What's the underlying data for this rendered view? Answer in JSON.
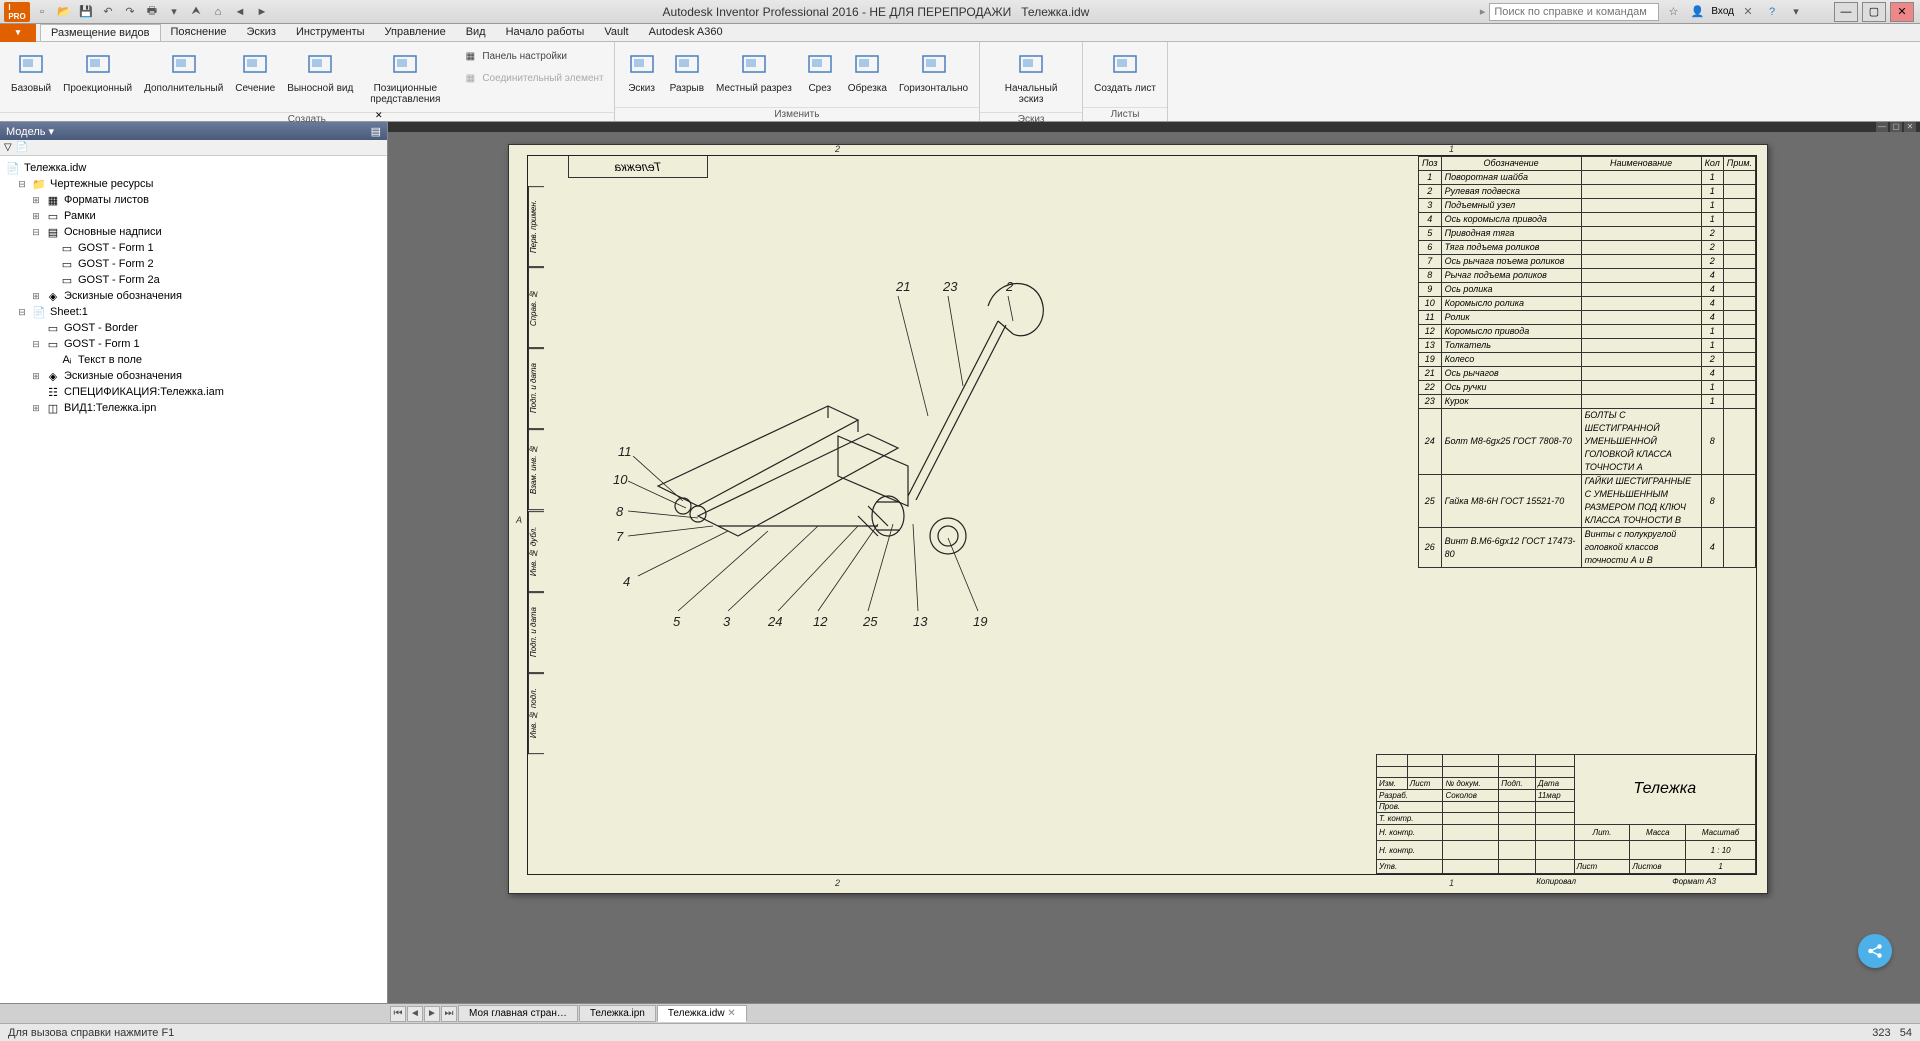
{
  "app": {
    "title_left": "Autodesk Inventor Professional 2016 - НЕ ДЛЯ ПЕРЕПРОДАЖИ",
    "title_doc": "Тележка.idw",
    "search_placeholder": "Поиск по справке и командам",
    "login": "Вход"
  },
  "qat": [
    "new",
    "open",
    "save",
    "undo",
    "redo",
    "print",
    "home",
    "back",
    "forward"
  ],
  "menus": [
    "Размещение видов",
    "Пояснение",
    "Эскиз",
    "Инструменты",
    "Управление",
    "Вид",
    "Начало работы",
    "Vault",
    "Autodesk A360"
  ],
  "ribbon": {
    "groups": [
      {
        "title": "Создать",
        "buttons": [
          {
            "label": "Базовый",
            "icon": "base-view"
          },
          {
            "label": "Проекционный",
            "icon": "projected-view"
          },
          {
            "label": "Дополнительный",
            "icon": "aux-view"
          },
          {
            "label": "Сечение",
            "icon": "section-view"
          },
          {
            "label": "Выносной вид",
            "icon": "detail-view"
          },
          {
            "label": "Позиционные представления",
            "icon": "overlay-view"
          }
        ],
        "side": [
          {
            "label": "Панель настройки",
            "icon": "nailboard",
            "disabled": false
          },
          {
            "label": "Соединительный элемент",
            "icon": "connector",
            "disabled": true
          }
        ]
      },
      {
        "title": "Изменить",
        "buttons": [
          {
            "label": "Эскиз",
            "icon": "sketch"
          },
          {
            "label": "Разрыв",
            "icon": "break"
          },
          {
            "label": "Местный разрез",
            "icon": "breakout"
          },
          {
            "label": "Срез",
            "icon": "slice"
          },
          {
            "label": "Обрезка",
            "icon": "crop"
          },
          {
            "label": "Горизонтально",
            "icon": "horizontal"
          }
        ]
      },
      {
        "title": "Эскиз",
        "buttons": [
          {
            "label": "Начальный эскиз",
            "icon": "start-sketch"
          }
        ]
      },
      {
        "title": "Листы",
        "buttons": [
          {
            "label": "Создать лист",
            "icon": "new-sheet"
          }
        ]
      }
    ]
  },
  "browser": {
    "title": "Модель",
    "root": "Тележка.idw",
    "nodes": [
      {
        "lvl": 1,
        "exp": "-",
        "icon": "folder",
        "label": "Чертежные ресурсы"
      },
      {
        "lvl": 2,
        "exp": "+",
        "icon": "sheets",
        "label": "Форматы листов"
      },
      {
        "lvl": 2,
        "exp": "+",
        "icon": "frame",
        "label": "Рамки"
      },
      {
        "lvl": 2,
        "exp": "-",
        "icon": "titleblk",
        "label": "Основные надписи"
      },
      {
        "lvl": 3,
        "exp": "",
        "icon": "form",
        "label": "GOST - Form 1"
      },
      {
        "lvl": 3,
        "exp": "",
        "icon": "form",
        "label": "GOST - Form 2"
      },
      {
        "lvl": 3,
        "exp": "",
        "icon": "form",
        "label": "GOST - Form 2a"
      },
      {
        "lvl": 2,
        "exp": "+",
        "icon": "symbols",
        "label": "Эскизные обозначения"
      },
      {
        "lvl": 1,
        "exp": "-",
        "icon": "sheet",
        "label": "Sheet:1"
      },
      {
        "lvl": 2,
        "exp": "",
        "icon": "border",
        "label": "GOST - Border"
      },
      {
        "lvl": 2,
        "exp": "-",
        "icon": "form",
        "label": "GOST - Form 1"
      },
      {
        "lvl": 3,
        "exp": "",
        "icon": "text",
        "label": "Текст в поле"
      },
      {
        "lvl": 2,
        "exp": "+",
        "icon": "symbols",
        "label": "Эскизные обозначения"
      },
      {
        "lvl": 2,
        "exp": "",
        "icon": "spec",
        "label": "СПЕЦИФИКАЦИЯ:Тележка.iam"
      },
      {
        "lvl": 2,
        "exp": "+",
        "icon": "view",
        "label": "ВИД1:Тележка.ipn"
      }
    ]
  },
  "sheet": {
    "title_rotated": "Тележка",
    "parts_header": {
      "poz": "Поз",
      "oboz": "Обозначение",
      "naim": "Наименование",
      "kol": "Кол",
      "prim": "Прим."
    },
    "parts": [
      {
        "n": "1",
        "o": "Поворотная шайба",
        "name": "",
        "k": "1"
      },
      {
        "n": "2",
        "o": "Рулевая подвеска",
        "name": "",
        "k": "1"
      },
      {
        "n": "3",
        "o": "Подъемный узел",
        "name": "",
        "k": "1"
      },
      {
        "n": "4",
        "o": "Ось коромысла привода",
        "name": "",
        "k": "1"
      },
      {
        "n": "5",
        "o": "Приводная тяга",
        "name": "",
        "k": "2"
      },
      {
        "n": "6",
        "o": "Тяга подъема роликов",
        "name": "",
        "k": "2"
      },
      {
        "n": "7",
        "o": "Ось рычага поъема роликов",
        "name": "",
        "k": "2"
      },
      {
        "n": "8",
        "o": "Рычаг подъема роликов",
        "name": "",
        "k": "4"
      },
      {
        "n": "9",
        "o": "Ось ролика",
        "name": "",
        "k": "4"
      },
      {
        "n": "10",
        "o": "Коромысло ролика",
        "name": "",
        "k": "4"
      },
      {
        "n": "11",
        "o": "Ролик",
        "name": "",
        "k": "4"
      },
      {
        "n": "12",
        "o": "Коромысло привода",
        "name": "",
        "k": "1"
      },
      {
        "n": "13",
        "o": "Толкатель",
        "name": "",
        "k": "1"
      },
      {
        "n": "19",
        "o": "Колесо",
        "name": "",
        "k": "2"
      },
      {
        "n": "21",
        "o": "Ось рычагов",
        "name": "",
        "k": "4"
      },
      {
        "n": "22",
        "o": "Ось ручки",
        "name": "",
        "k": "1"
      },
      {
        "n": "23",
        "o": "Курок",
        "name": "",
        "k": "1"
      },
      {
        "n": "24",
        "o": "Болт М8-6gх25 ГОСТ 7808-70",
        "name": "БОЛТЫ С ШЕСТИГРАННОЙ УМЕНЬШЕННОЙ ГОЛОВКОЙ КЛАССА ТОЧНОСТИ А",
        "k": "8"
      },
      {
        "n": "25",
        "o": "Гайка М8-6Н ГОСТ 15521-70",
        "name": "ГАЙКИ ШЕСТИГРАННЫЕ С УМЕНЬШЕННЫМ РАЗМЕРОМ ПОД КЛЮЧ КЛАССА ТОЧНОСТИ В",
        "k": "8"
      },
      {
        "n": "26",
        "o": "Винт В.М6-6gх12 ГОСТ 17473-80",
        "name": "Винты с полукруглой головкой классов точности А и В",
        "k": "4"
      }
    ],
    "callouts_top": [
      "21",
      "23",
      "2"
    ],
    "callouts_left": [
      "11",
      "10",
      "8",
      "7",
      "4"
    ],
    "callouts_bottom": [
      "5",
      "3",
      "24",
      "12",
      "25",
      "13",
      "19"
    ],
    "title_block": {
      "name": "Тележка",
      "scale": "1 : 10",
      "sheet_lbl": "Лист",
      "sheets_lbl": "Листов",
      "sheets": "1",
      "lit": "Лит.",
      "mass": "Масса",
      "mscale": "Масштаб",
      "rows": [
        "Изм.",
        "Лист",
        "№ докум.",
        "Подп.",
        "Дата"
      ],
      "role_rows": [
        "Разраб.",
        "Пров.",
        "Т. контр.",
        "Н. контр.",
        "Утв."
      ],
      "developer": "Соколов",
      "date": "11мар",
      "kopirovai": "Копировал",
      "format": "Формат А3"
    },
    "side_rows": [
      "Перв. примен.",
      "Справ. №",
      "Подп. и дата",
      "Взам. инв. №",
      "Инв. № дубл.",
      "Подп. и дата",
      "Инв. № подл."
    ]
  },
  "doc_tabs": [
    "Моя главная стран…",
    "Тележка.ipn",
    "Тележка.idw"
  ],
  "active_tab": 2,
  "status": {
    "left": "Для вызова справки нажмите F1",
    "coord1": "323",
    "coord2": "54"
  }
}
